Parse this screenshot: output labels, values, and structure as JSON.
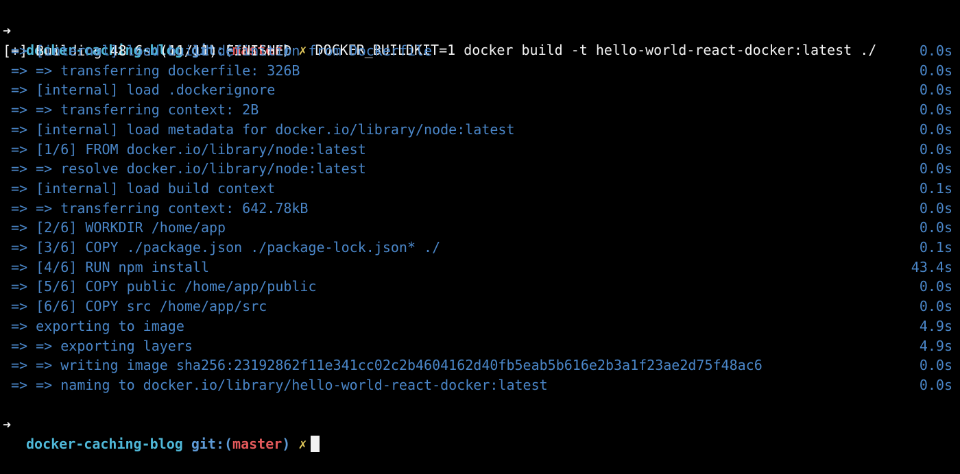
{
  "terminal": {
    "prompt": {
      "arrow": "➜",
      "directory": "docker-caching-blog",
      "git_prefix": "git:(",
      "branch": "master",
      "git_suffix": ")",
      "dirty_marker": "✗"
    },
    "command": "DOCKER_BUILDKIT=1 docker build -t hello-world-react-docker:latest ./",
    "header": "[+] Building 48.6s (11/11) FINISHED",
    "steps": [
      {
        "text": "=> [internal] load build definition from Dockerfile",
        "time": "0.0s"
      },
      {
        "text": "=> => transferring dockerfile: 326B",
        "time": "0.0s"
      },
      {
        "text": "=> [internal] load .dockerignore",
        "time": "0.0s"
      },
      {
        "text": "=> => transferring context: 2B",
        "time": "0.0s"
      },
      {
        "text": "=> [internal] load metadata for docker.io/library/node:latest",
        "time": "0.0s"
      },
      {
        "text": "=> [1/6] FROM docker.io/library/node:latest",
        "time": "0.0s"
      },
      {
        "text": "=> => resolve docker.io/library/node:latest",
        "time": "0.0s"
      },
      {
        "text": "=> [internal] load build context",
        "time": "0.1s"
      },
      {
        "text": "=> => transferring context: 642.78kB",
        "time": "0.0s"
      },
      {
        "text": "=> [2/6] WORKDIR /home/app",
        "time": "0.0s"
      },
      {
        "text": "=> [3/6] COPY ./package.json ./package-lock.json* ./",
        "time": "0.1s"
      },
      {
        "text": "=> [4/6] RUN npm install",
        "time": "43.4s"
      },
      {
        "text": "=> [5/6] COPY public /home/app/public",
        "time": "0.0s"
      },
      {
        "text": "=> [6/6] COPY src /home/app/src",
        "time": "0.0s"
      },
      {
        "text": "=> exporting to image",
        "time": "4.9s"
      },
      {
        "text": "=> => exporting layers",
        "time": "4.9s"
      },
      {
        "text": "=> => writing image sha256:23192862f11e341cc02c2b4604162d40fb5eab5b616e2b3a1f23ae2d75f48ac6",
        "time": "0.0s"
      },
      {
        "text": "=> => naming to docker.io/library/hello-world-react-docker:latest",
        "time": "0.0s"
      }
    ]
  },
  "colors": {
    "background": "#000000",
    "directory": "#4fb8d8",
    "branch": "#e4595b",
    "step_text": "#4a86c8"
  }
}
